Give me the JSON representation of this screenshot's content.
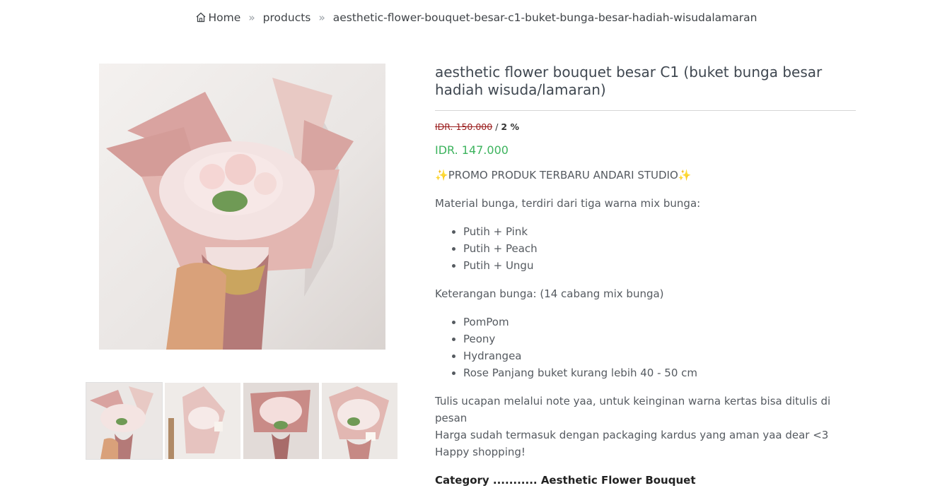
{
  "breadcrumb": {
    "home": "Home",
    "separator": "»",
    "products": "products",
    "current": "aesthetic-flower-bouquet-besar-c1-buket-bunga-besar-hadiah-wisudalamaran"
  },
  "product": {
    "title": "aesthetic flower bouquet besar C1 (buket bunga besar hadiah wisuda/lamaran)",
    "price_old": "IDR. 150.000",
    "price_sep": "/",
    "discount": "2 %",
    "price_new": "IDR. 147.000",
    "promo": "PROMO PRODUK TERBARU ANDARI STUDIO",
    "material_intro": "Material bunga, terdiri dari tiga warna mix bunga:",
    "materials": [
      "Putih + Pink",
      "Putih + Peach",
      "Putih + Ungu"
    ],
    "flowers_intro": "Keterangan bunga: (14 cabang mix bunga)",
    "flowers": [
      "PomPom",
      "Peony",
      "Hydrangea",
      "Rose Panjang buket kurang lebih 40 - 50 cm"
    ],
    "note_lines": [
      "Tulis ucapan melalui note yaa, untuk keinginan warna kertas bisa ditulis di pesan",
      "Harga sudah termasuk dengan packaging kardus yang aman yaa dear <3",
      "Happy shopping!"
    ],
    "category_cut": "Category ........... Aesthetic Flower Bouquet"
  },
  "gallery": {
    "thumb_count": 4
  }
}
